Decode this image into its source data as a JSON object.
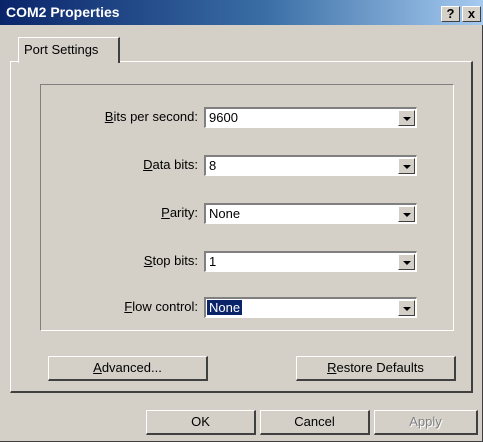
{
  "window": {
    "title": "COM2 Properties",
    "help_label": "?",
    "close_label": "x"
  },
  "tabs": [
    {
      "label": "Port Settings"
    }
  ],
  "fields": [
    {
      "access_key": "B",
      "label_rest": "its per second:",
      "value": "9600"
    },
    {
      "access_key": "D",
      "label_rest": "ata bits:",
      "value": "8"
    },
    {
      "access_key": "P",
      "label_rest": "arity:",
      "value": "None"
    },
    {
      "access_key": "S",
      "label_rest": "top bits:",
      "value": "1"
    },
    {
      "access_key": "F",
      "label_rest": "low control:",
      "value": "None"
    }
  ],
  "panel_buttons": {
    "advanced": {
      "access_key": "A",
      "label_rest": "dvanced..."
    },
    "restore": {
      "access_key": "R",
      "label_rest": "estore Defaults"
    }
  },
  "dialog_buttons": {
    "ok": "OK",
    "cancel": "Cancel",
    "apply": "Apply"
  },
  "colors": {
    "title_start": "#0a246a",
    "title_end": "#a6caf0",
    "face": "#d4d0c8",
    "selection": "#0a246a"
  }
}
